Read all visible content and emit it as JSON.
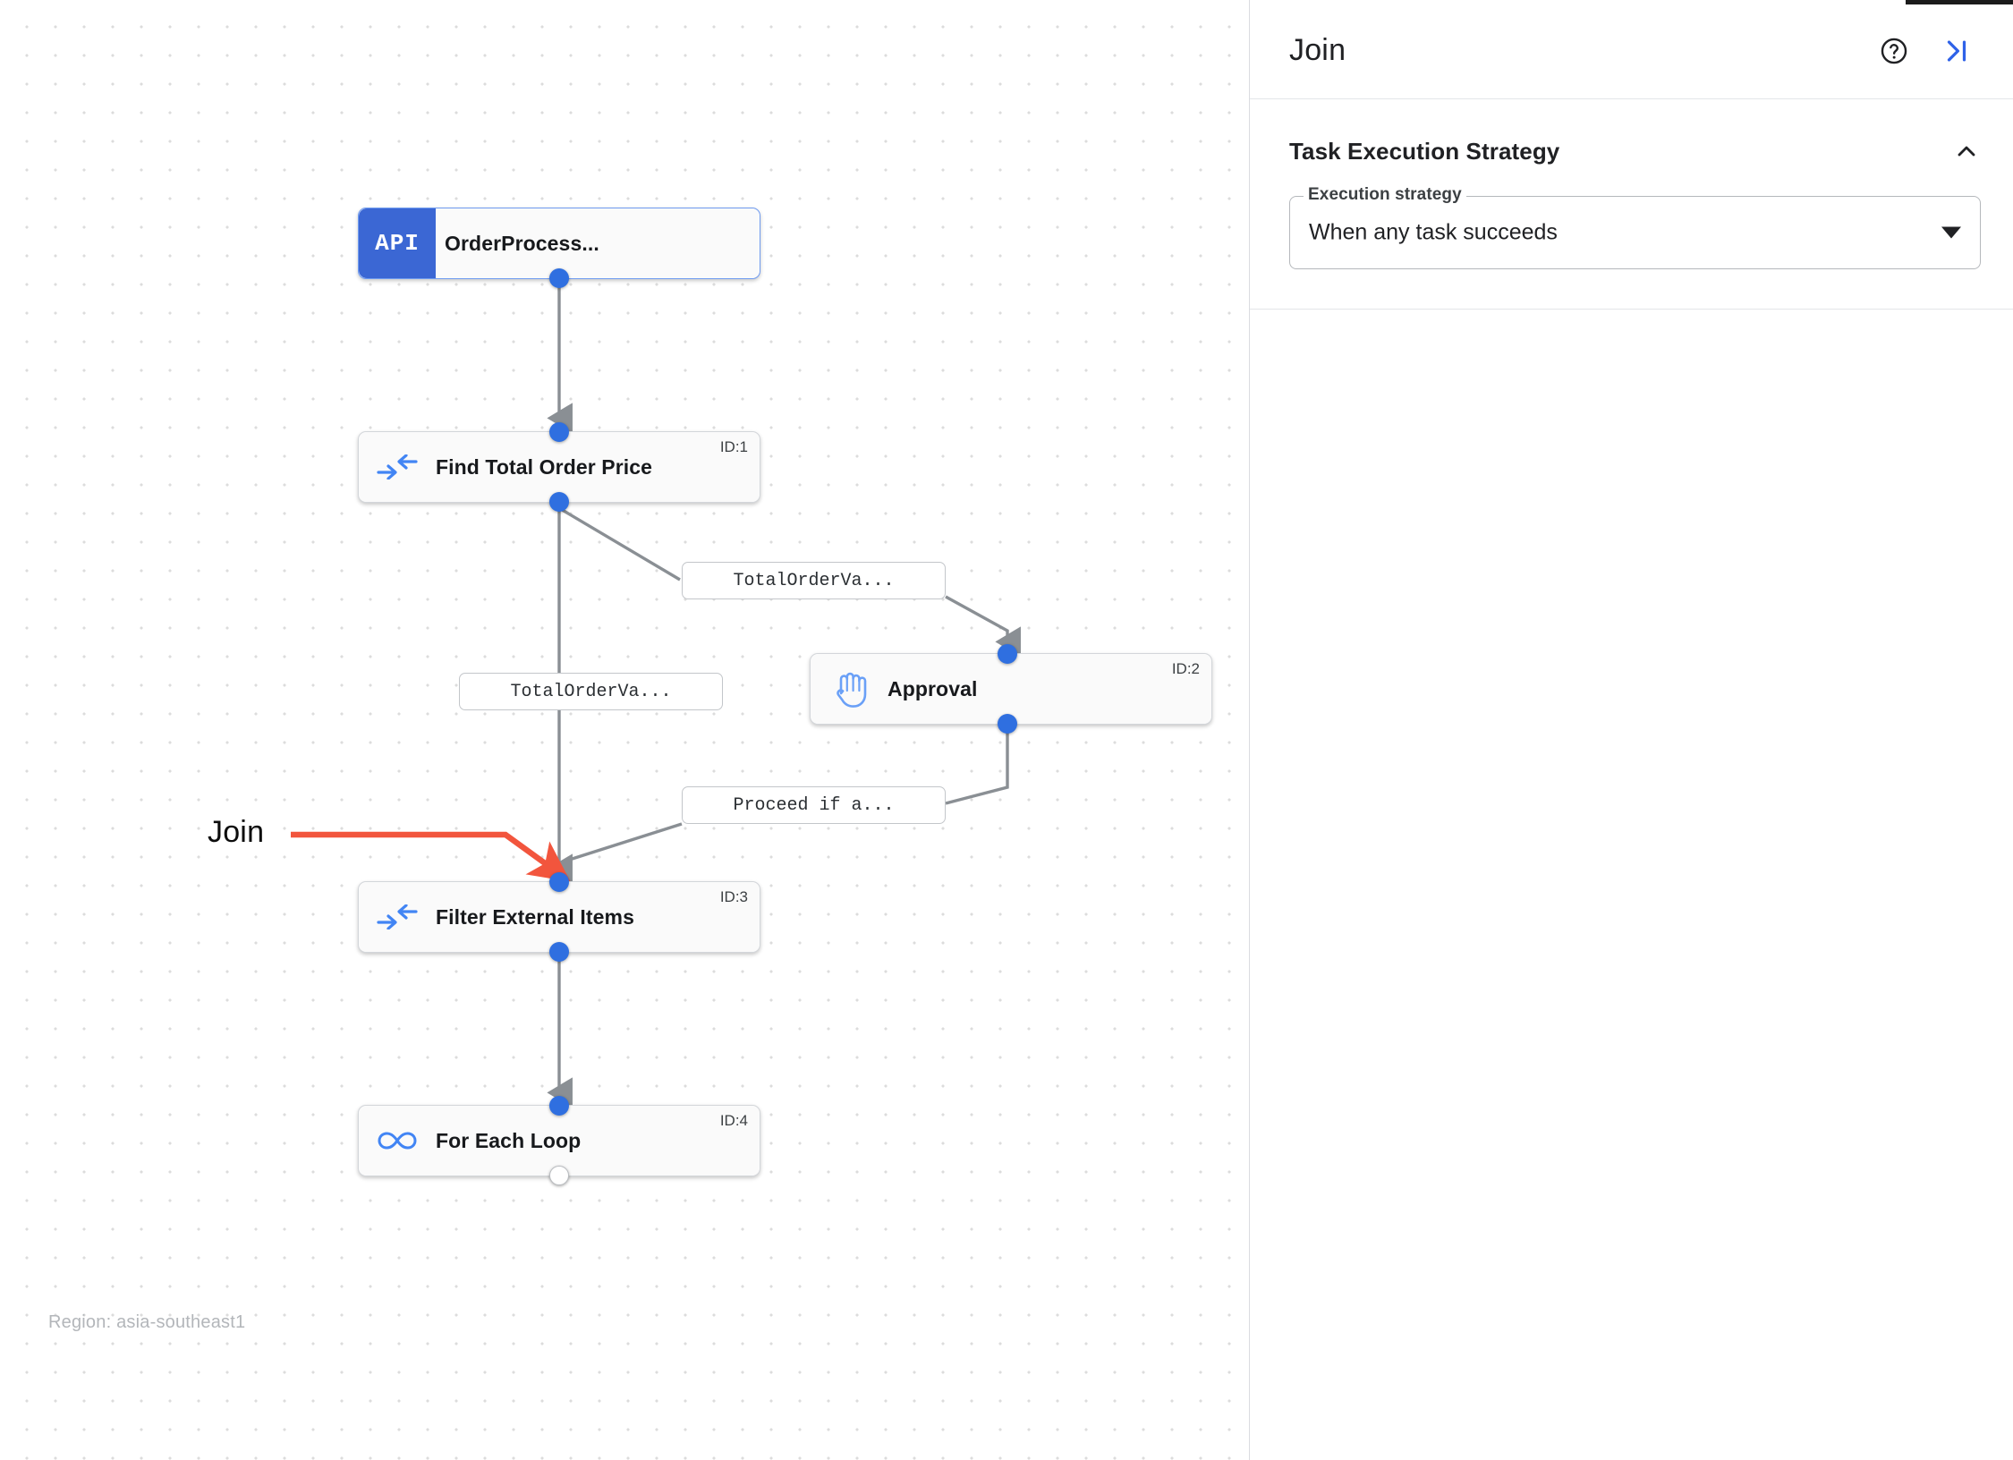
{
  "canvas": {
    "region_caption": "Region: asia-southeast1",
    "annotation": {
      "label": "Join",
      "color": "#f2553d"
    },
    "nodes": [
      {
        "id": "trigger",
        "type": "api-trigger",
        "badge": "API",
        "title": "OrderProcess...",
        "id_label": "",
        "icon": "api-badge"
      },
      {
        "id": "find",
        "type": "task",
        "title": "Find Total Order Price",
        "id_label": "ID:1",
        "icon": "merge-arrows-icon"
      },
      {
        "id": "approval",
        "type": "task",
        "title": "Approval",
        "id_label": "ID:2",
        "icon": "hand-icon"
      },
      {
        "id": "filter",
        "type": "task",
        "title": "Filter External Items",
        "id_label": "ID:3",
        "icon": "merge-arrows-icon"
      },
      {
        "id": "loop",
        "type": "task",
        "title": "For Each Loop",
        "id_label": "ID:4",
        "icon": "infinity-icon"
      }
    ],
    "edge_labels": [
      {
        "id": "a",
        "text": "TotalOrderVa..."
      },
      {
        "id": "b",
        "text": "TotalOrderVa..."
      },
      {
        "id": "c",
        "text": "Proceed if a..."
      }
    ]
  },
  "panel": {
    "title": "Join",
    "help_icon": "help-circle-icon",
    "collapse_icon": "collapse-right-icon",
    "sections": [
      {
        "title": "Task Execution Strategy",
        "collapse_icon": "chevron-up-icon",
        "field": {
          "label": "Execution strategy",
          "value": "When any task succeeds",
          "dropdown_icon": "triangle-down-icon"
        }
      }
    ]
  },
  "colors": {
    "accent_blue": "#2f6fe0",
    "api_chip": "#3b67d4",
    "annotation_red": "#f2553d",
    "edge_gray": "#8a8f94"
  }
}
